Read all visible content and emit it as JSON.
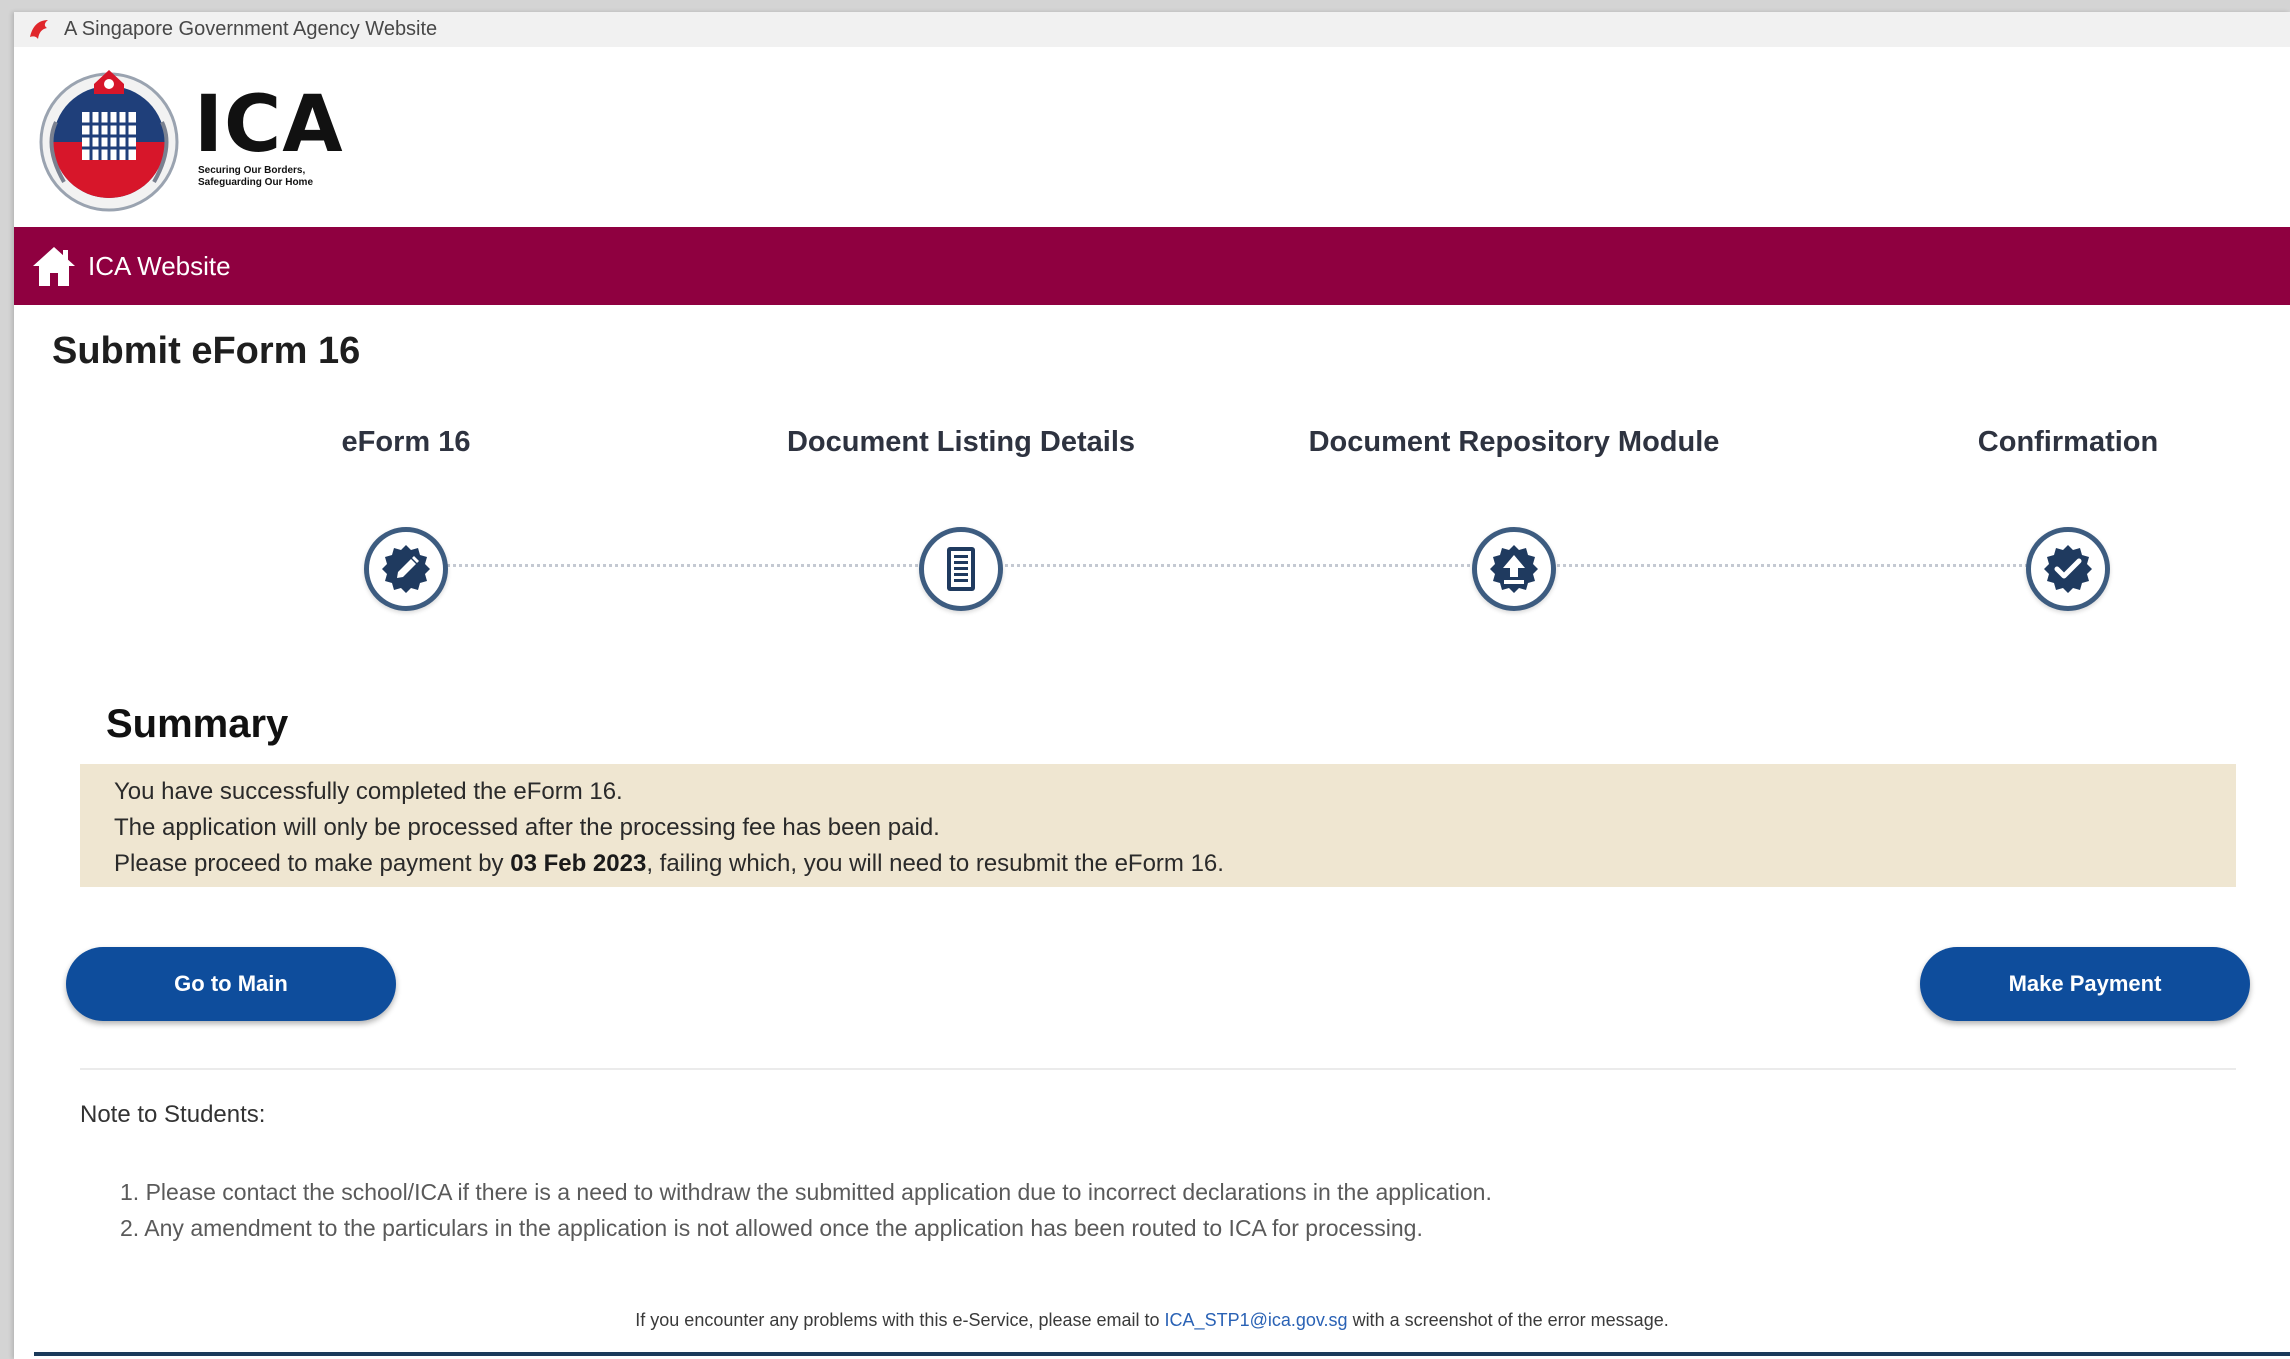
{
  "gov_banner": {
    "text": "A Singapore Government Agency Website"
  },
  "logo": {
    "name": "ICA",
    "tagline_1": "Securing Our Borders,",
    "tagline_2": "Safeguarding Our Home"
  },
  "nav": {
    "home_label": "ICA Website"
  },
  "page_title": "Submit eForm 16",
  "steps": [
    {
      "label": "eForm 16",
      "icon": "edit-badge-icon"
    },
    {
      "label": "Document Listing Details",
      "icon": "document-list-icon"
    },
    {
      "label": "Document Repository Module",
      "icon": "upload-icon"
    },
    {
      "label": "Confirmation",
      "icon": "check-badge-icon"
    }
  ],
  "summary": {
    "title": "Summary",
    "line1": "You have successfully completed the eForm 16.",
    "line2": "The application will only be processed after the processing fee has been paid.",
    "line3_prefix": "Please proceed to make payment by ",
    "line3_date": "03 Feb 2023",
    "line3_suffix": ", failing which, you will need to resubmit the eForm 16."
  },
  "buttons": {
    "go_to_main": "Go to Main",
    "make_payment": "Make Payment"
  },
  "notes": {
    "title": "Note to Students:",
    "items": [
      "1. Please contact the school/ICA if there is a need to withdraw the submitted application due to incorrect declarations in the application.",
      "2. Any amendment to the particulars in the application is not allowed once the application has been routed to ICA for processing."
    ]
  },
  "footer": {
    "prefix": "If you encounter any problems with this e-Service, please email to ",
    "email": "ICA_STP1@ica.gov.sg",
    "suffix": " with a screenshot of the error message."
  },
  "colors": {
    "nav_bar": "#8f0040",
    "button": "#0e4d9c",
    "summary_bg": "#efe6d1",
    "step_icon": "#3d5c80"
  }
}
